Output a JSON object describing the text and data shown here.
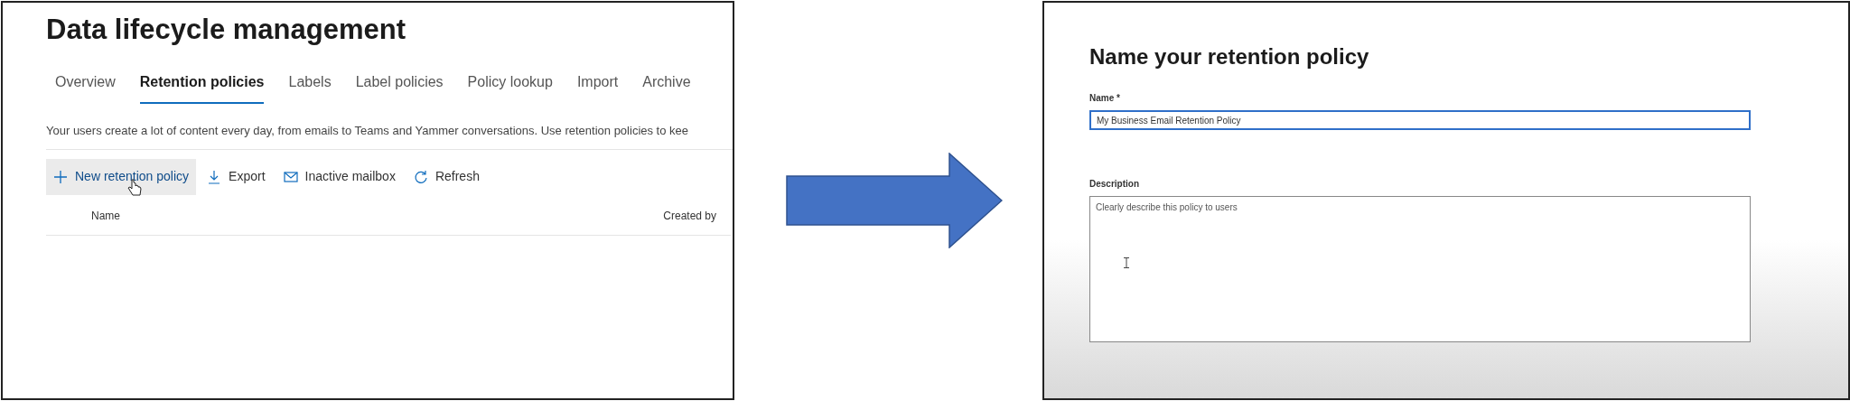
{
  "before": {
    "title": "Data lifecycle management",
    "tabs": [
      {
        "label": "Overview",
        "selected": false
      },
      {
        "label": "Retention policies",
        "selected": true
      },
      {
        "label": "Labels",
        "selected": false
      },
      {
        "label": "Label policies",
        "selected": false
      },
      {
        "label": "Policy lookup",
        "selected": false
      },
      {
        "label": "Import",
        "selected": false
      },
      {
        "label": "Archive",
        "selected": false
      }
    ],
    "intro": "Your users create a lot of content every day, from emails to Teams and Yammer conversations. Use retention policies to kee",
    "toolbar": [
      {
        "kind": "add",
        "label": "New retention policy",
        "hovered": true
      },
      {
        "kind": "export",
        "label": "Export",
        "hovered": false
      },
      {
        "kind": "mailbox",
        "label": "Inactive mailbox",
        "hovered": false
      },
      {
        "kind": "refresh",
        "label": "Refresh",
        "hovered": false
      }
    ],
    "table": {
      "columns": [
        "Name",
        "Created by"
      ]
    }
  },
  "after": {
    "title": "Name your retention policy",
    "name_field": {
      "label": "Name *",
      "value": "My Business Email Retention Policy",
      "focused": true
    },
    "description_field": {
      "label": "Description",
      "placeholder": "Clearly describe this policy to users",
      "focused": false
    }
  }
}
